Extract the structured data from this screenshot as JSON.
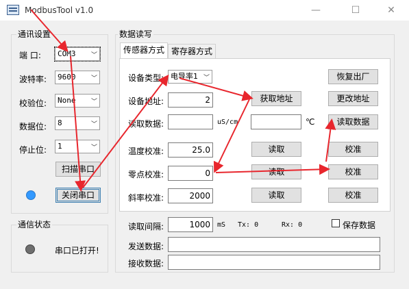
{
  "window": {
    "title": "ModbusTool v1.0",
    "minimize": "—",
    "maximize": "☐",
    "close": "✕"
  },
  "comm": {
    "group_title": "通讯设置",
    "port_label": "端  口:",
    "port_value": "COM3",
    "baud_label": "波特率:",
    "baud_value": "9600",
    "parity_label": "校验位:",
    "parity_value": "None",
    "databits_label": "数据位:",
    "databits_value": "8",
    "stopbits_label": "停止位:",
    "stopbits_value": "1",
    "scan_button": "扫描串口",
    "close_button": "关闭串口",
    "led_color": "#3399ff"
  },
  "status": {
    "group_title": "通信状态",
    "text": "串口已打开!",
    "led_color": "#6e6e6e"
  },
  "rw": {
    "group_title": "数据读写",
    "tabs": [
      "传感器方式",
      "寄存器方式"
    ],
    "device_type_label": "设备类型:",
    "device_type_value": "电导率1",
    "restore_button": "恢复出厂",
    "device_addr_label": "设备地址:",
    "device_addr_value": "2",
    "get_addr_button": "获取地址",
    "change_addr_button": "更改地址",
    "read_data_label": "读取数据:",
    "read_data_value1": "",
    "unit1": "uS/cm",
    "read_data_value2": "",
    "unit2": "℃",
    "read_data_button": "读取数据",
    "temp_label": "温度校准:",
    "temp_value": "25.0",
    "temp_read": "读取",
    "temp_calib": "校准",
    "zero_label": "零点校准:",
    "zero_value": "0",
    "zero_read": "读取",
    "zero_calib": "校准",
    "slope_label": "斜率校准:",
    "slope_value": "2000",
    "slope_read": "读取",
    "slope_calib": "校准"
  },
  "bottom": {
    "interval_label": "读取间隔:",
    "interval_value": "1000",
    "interval_unit": "mS",
    "tx_label": "Tx: 0",
    "rx_label": "Rx: 0",
    "save_label": "保存数据",
    "send_label": "发送数据:",
    "send_value": "",
    "recv_label": "接收数据:",
    "recv_value": ""
  },
  "annotation_color": "#e8262d"
}
